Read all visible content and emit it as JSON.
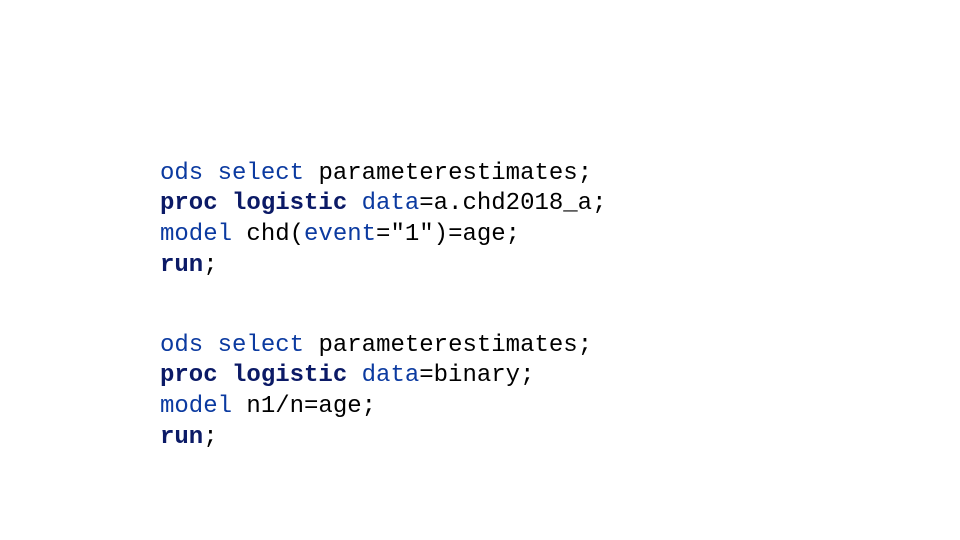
{
  "block1": {
    "line1": {
      "kw_ods": "ods",
      "sp1": " ",
      "kw_select": "select",
      "sp2": " ",
      "rest": "parameterestimates;"
    },
    "line2": {
      "kw_proc": "proc",
      "sp1": " ",
      "kw_logistic": "logistic",
      "sp2": " ",
      "kw_data": "data",
      "rest": "=a.chd2018_a;"
    },
    "line3": {
      "kw_model": "model",
      "sp1": " ",
      "mid1": "chd(",
      "kw_event": "event",
      "mid2": "=",
      "str": "\"1\"",
      "rest": ")=age;"
    },
    "line4": {
      "kw_run": "run",
      "rest": ";"
    }
  },
  "block2": {
    "line1": {
      "kw_ods": "ods",
      "sp1": " ",
      "kw_select": "select",
      "sp2": " ",
      "rest": "parameterestimates;"
    },
    "line2": {
      "kw_proc": "proc",
      "sp1": " ",
      "kw_logistic": "logistic",
      "sp2": " ",
      "kw_data": "data",
      "rest": "=binary;"
    },
    "line3": {
      "kw_model": "model",
      "sp1": " ",
      "rest": "n1/n=age;"
    },
    "line4": {
      "kw_run": "run",
      "rest": ";"
    }
  }
}
